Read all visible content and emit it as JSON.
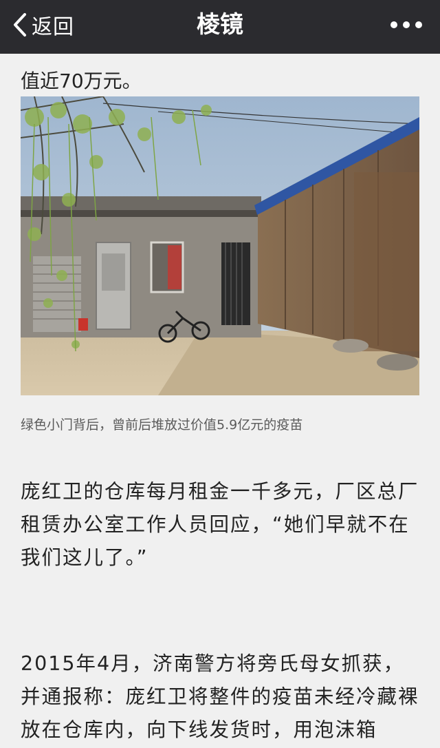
{
  "navbar": {
    "back_label": "返回",
    "title": "棱镜"
  },
  "article": {
    "lead_line": "值近70万元。",
    "image_caption": "绿色小门背后，曾前后堆放过价值5.9亿元的疫苗",
    "paragraph1": "庞红卫的仓库每月租金一千多元，厂区总厂租赁办公室工作人员回应，“她们早就不在我们这儿了。”",
    "paragraph2": "2015年4月，济南警方将旁氏母女抓获，并通报称：庞红卫将整件的疫苗未经冷藏裸放在仓库内，向下线发货时，用泡沫箱"
  }
}
